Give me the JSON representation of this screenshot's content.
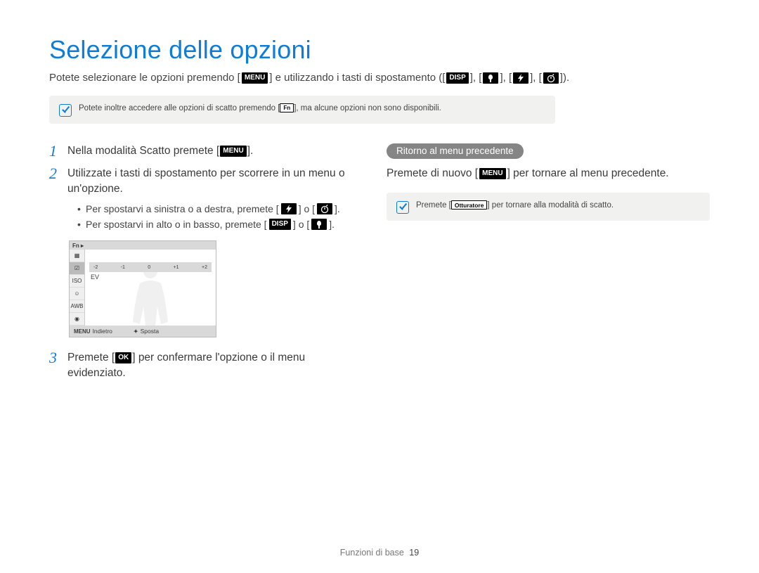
{
  "title": "Selezione delle opzioni",
  "intro": {
    "part1": "Potete selezionare le opzioni premendo [",
    "part2": "] e utilizzando i tasti di spostamento ([",
    "part3": "], [",
    "part4": "], [",
    "part5": "], [",
    "part6": "]).",
    "key_menu": "MENU",
    "key_disp": "DISP"
  },
  "note1": {
    "part1": "Potete inoltre accedere alle opzioni di scatto premendo [",
    "key_fn": "Fn",
    "part2": "], ma alcune opzioni non sono disponibili."
  },
  "steps": {
    "s1": {
      "num": "1",
      "part1": "Nella modalità Scatto premete [",
      "key": "MENU",
      "part2": "]."
    },
    "s2": {
      "num": "2",
      "text": "Utilizzate i tasti di spostamento per scorrere in un menu o un'opzione.",
      "sub1": {
        "part1": "Per spostarvi a sinistra o a destra, premete [",
        "part2": "] o [",
        "part3": "]."
      },
      "sub2": {
        "part1": "Per spostarvi in alto o in basso, premete [",
        "key_disp": "DISP",
        "part2": "] o [",
        "part3": "]."
      }
    },
    "s3": {
      "num": "3",
      "part1": "Premete [",
      "key": "OK",
      "part2": "] per confermare l'opzione o il menu evidenziato."
    }
  },
  "camera_screen": {
    "fn_label": "Fn ▸",
    "ev_ticks": [
      "-2",
      "-1",
      "0",
      "+1",
      "+2"
    ],
    "ev_label": "EV",
    "footer_back_key": "MENU",
    "footer_back": "Indietro",
    "footer_move_key": "✦",
    "footer_move": "Sposta",
    "sidebar_icons": [
      "▦",
      "☑",
      "ISO",
      "☺",
      "AWB",
      "◉"
    ]
  },
  "right": {
    "pill": "Ritorno al menu precedente",
    "para_part1": "Premete di nuovo [",
    "para_key": "MENU",
    "para_part2": "] per tornare al menu precedente.",
    "note_part1": "Premete [",
    "note_key": "Otturatore",
    "note_part2": "] per tornare alla modalità di scatto."
  },
  "footer": {
    "section": "Funzioni di base",
    "page": "19"
  }
}
